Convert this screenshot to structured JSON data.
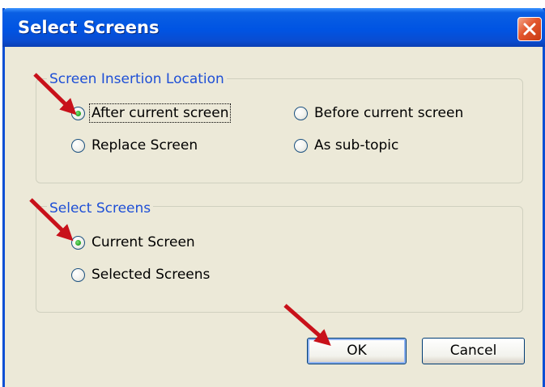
{
  "window": {
    "title": "Select Screens",
    "close_icon": "close-icon"
  },
  "insertion_group": {
    "legend": "Screen Insertion Location",
    "options": [
      {
        "label": "After current screen",
        "checked": true
      },
      {
        "label": "Before current screen",
        "checked": false
      },
      {
        "label": "Replace Screen",
        "checked": false
      },
      {
        "label": "As sub-topic",
        "checked": false
      }
    ]
  },
  "screens_group": {
    "legend": "Select Screens",
    "options": [
      {
        "label": "Current Screen",
        "checked": true
      },
      {
        "label": "Selected Screens",
        "checked": false
      }
    ]
  },
  "buttons": {
    "ok": "OK",
    "cancel": "Cancel"
  },
  "colors": {
    "title_bar": "#0054e3",
    "dialog_bg": "#ece9d8",
    "legend_text": "#1e4fd6",
    "annotation_arrow": "#c8111a"
  }
}
